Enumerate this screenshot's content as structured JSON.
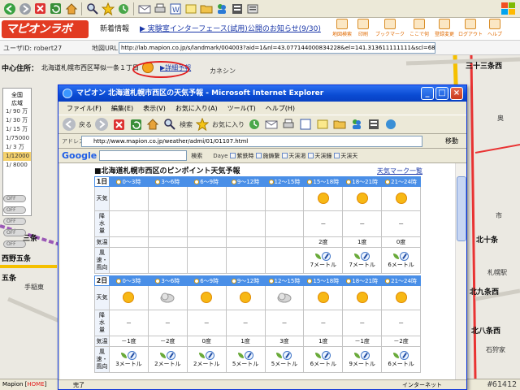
{
  "outer_browser": {
    "header": {
      "logo_text": "マピオンラボ",
      "news_label": "新着情報",
      "news_text": "▶ 実験室インターフェース(試用)公開のお知らせ(9/30)",
      "tools": [
        "地図検索",
        "印刷",
        "ブックマーク",
        "ここで何",
        "登録変更",
        "ログアウト",
        "ヘルプ"
      ]
    },
    "user_row": {
      "user_label": "ユーザID: robert27",
      "map_url_label": "地図URL",
      "map_url": "http://lab.mapion.co.jp/s/landmark/004003?aid=1&nl=43.077144000834228&el=141.313611111111&scl=68&ef=0&opt=0&ly=0"
    },
    "map": {
      "center_title": "中心住所：",
      "center_address": "北海道札幌市西区琴似一条１丁目",
      "detail_link": "▶詳細予報",
      "scale_heading": [
        "全国",
        "広域"
      ],
      "scales": [
        "1/ 90 万",
        "1/ 30 万",
        "1/ 15 万",
        "1/75000",
        "1/ 3 万",
        "1/12000",
        "1/ 8000"
      ],
      "selected_scale": "1/12000",
      "toggles": [
        "OFF",
        "OFF",
        "OFF",
        "OFF",
        "OFF"
      ],
      "labels": {
        "kanon": "カネシン",
        "sanjusan_nishi": "三十三条西",
        "sanjo": "三条",
        "nishino_gojo": "西野五条",
        "gojo": "五条",
        "teine": "手稲東",
        "kita_jujo": "北十条",
        "kita_kujo": "北九条西",
        "kita_hachijo": "北八条西",
        "sapporo": "札幌駅",
        "ishiya": "石狩家",
        "sapporo_city": "市",
        "oku": "奥"
      }
    },
    "status": {
      "prefix": "Mapion [",
      "home": "HOME",
      "suffix": "]"
    }
  },
  "popup": {
    "title": "マピオン  北海道札幌市西区の天気予報 - Microsoft Internet Explorer",
    "menu": [
      "ファイル(F)",
      "編集(E)",
      "表示(V)",
      "お気に入り(A)",
      "ツール(T)",
      "ヘルプ(H)"
    ],
    "toolbar": {
      "back": "戻る",
      "search": "検索",
      "favorites": "お気に入り"
    },
    "address_label": "アドレス(D)",
    "address": "http://www.mapion.co.jp/weather/admi/01/01107.html",
    "go_label": "移動",
    "google": {
      "logo": "Google",
      "search_label": "検索",
      "tag": "Daye",
      "words": [
        "紫鉄時",
        "施鋳繋",
        "天渓渇",
        "天渓鐘",
        "天渓天"
      ]
    },
    "status_left": "完了",
    "status_right": "インターネット"
  },
  "forecast": {
    "heading": "■北海道札幌市西区のピンポイント天気予報",
    "legend_link": "天気マーク一覧",
    "time_slots": [
      "0〜3時",
      "3〜6時",
      "6〜9時",
      "9〜12時",
      "12〜15時",
      "15〜18時",
      "18〜21時",
      "21〜24時"
    ],
    "row_labels": {
      "weather": "天気",
      "precip": [
        "降",
        "水",
        "量"
      ],
      "temp": "気温",
      "wind": [
        "風速・",
        "風向"
      ]
    },
    "days": [
      {
        "day": "1日",
        "weather": [
          "",
          "",
          "",
          "",
          "",
          "sunny",
          "sunny",
          "sunny"
        ],
        "precip": [
          "",
          "",
          "",
          "",
          "",
          "－",
          "－",
          "－"
        ],
        "temp": [
          "",
          "",
          "",
          "",
          "",
          "2度",
          "1度",
          "0度"
        ],
        "wind": [
          "",
          "",
          "",
          "",
          "",
          "7メートル",
          "7メートル",
          "6メートル"
        ]
      },
      {
        "day": "2日",
        "weather": [
          "sunny",
          "cloudy",
          "sunny",
          "sunny",
          "cloudy",
          "sunny",
          "sunny",
          "sunny"
        ],
        "precip": [
          "－",
          "－",
          "－",
          "－",
          "－",
          "－",
          "－",
          "－"
        ],
        "temp": [
          "－1度",
          "－2度",
          "0度",
          "1度",
          "3度",
          "1度",
          "－1度",
          "－2度"
        ],
        "wind": [
          "3メートル",
          "2メートル",
          "2メートル",
          "5メートル",
          "5メートル",
          "6メートル",
          "9メートル",
          "6メートル"
        ]
      }
    ]
  },
  "watermark": "#61412",
  "colors": {
    "popup_title": "#0a4bd3",
    "header_bar": "#4a8fe7",
    "mapion_red": "#e23b22",
    "sun": "#f7b815"
  }
}
